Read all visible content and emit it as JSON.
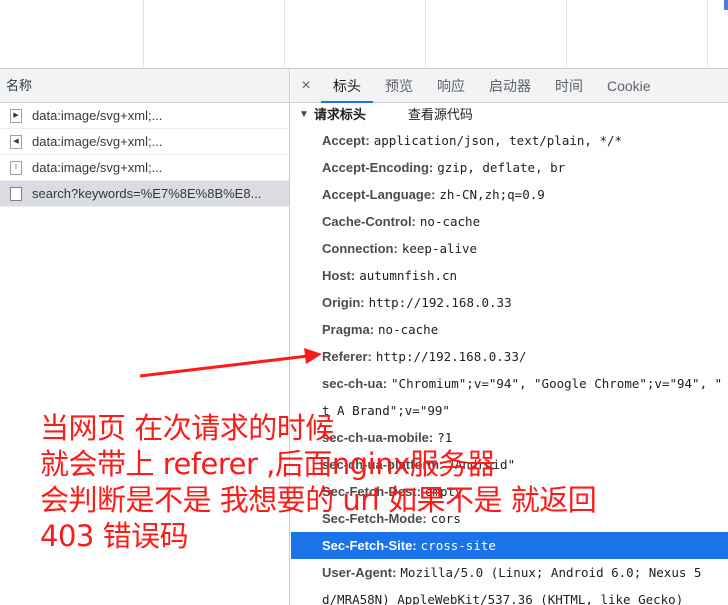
{
  "left_pane": {
    "header": "名称",
    "requests": [
      {
        "icon": "play-icon",
        "name": "data:image/svg+xml;..."
      },
      {
        "icon": "speaker-icon",
        "name": "data:image/svg+xml;..."
      },
      {
        "icon": "info-icon",
        "name": "data:image/svg+xml;..."
      },
      {
        "icon": "document-icon",
        "name": "search?keywords=%E7%8E%8B%E8..."
      }
    ]
  },
  "tabs": {
    "close": "×",
    "items": [
      "标头",
      "预览",
      "响应",
      "启动器",
      "时间",
      "Cookie"
    ],
    "active": "标头"
  },
  "section": {
    "title": "请求标头",
    "view_source": "查看源代码"
  },
  "headers": [
    {
      "k": "Accept:",
      "v": "application/json, text/plain, */*"
    },
    {
      "k": "Accept-Encoding:",
      "v": "gzip, deflate, br"
    },
    {
      "k": "Accept-Language:",
      "v": "zh-CN,zh;q=0.9"
    },
    {
      "k": "Cache-Control:",
      "v": "no-cache"
    },
    {
      "k": "Connection:",
      "v": "keep-alive"
    },
    {
      "k": "Host:",
      "v": "autumnfish.cn"
    },
    {
      "k": "Origin:",
      "v": "http://192.168.0.33"
    },
    {
      "k": "Pragma:",
      "v": "no-cache"
    },
    {
      "k": "Referer:",
      "v": "http://192.168.0.33/"
    },
    {
      "k": "sec-ch-ua:",
      "v": "\"Chromium\";v=\"94\", \"Google Chrome\";v=\"94\", \"",
      "cont": "t A Brand\";v=\"99\""
    },
    {
      "k": "sec-ch-ua-mobile:",
      "v": "?1"
    },
    {
      "k": "sec-ch-ua-platform:",
      "v": "\"Android\""
    },
    {
      "k": "Sec-Fetch-Dest:",
      "v": "empty"
    },
    {
      "k": "Sec-Fetch-Mode:",
      "v": "cors"
    },
    {
      "k": "Sec-Fetch-Site:",
      "v": "cross-site",
      "selected": true
    },
    {
      "k": "User-Agent:",
      "v": "Mozilla/5.0 (Linux; Android 6.0; Nexus 5",
      "cont": "d/MRA58N) AppleWebKit/537.36 (KHTML, like Gecko)"
    }
  ],
  "annotation": {
    "lines": [
      "当网页 在次请求的时候",
      "就会带上 referer ,后面nginx服务器",
      "会判断是不是 我想要的 url 如果不是 就返回",
      "403 错误码"
    ],
    "color": "#ff1a1a"
  }
}
